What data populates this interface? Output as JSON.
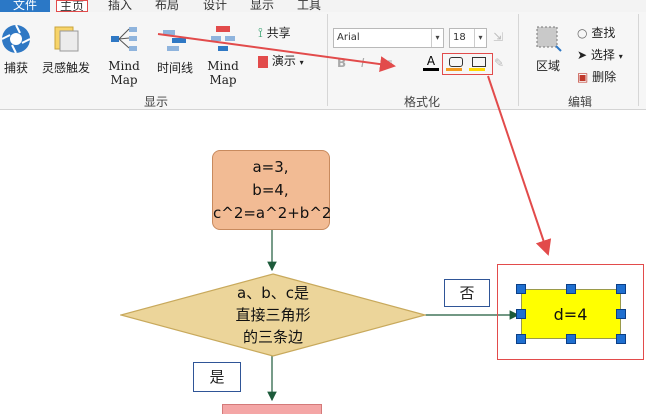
{
  "tabs": [
    "文件",
    "主页",
    "插入",
    "布局",
    "设计",
    "显示",
    "工具"
  ],
  "ribbon": {
    "capture": "捕获",
    "inspire": "灵感触发",
    "mindmap1": "Mind Map",
    "timeline": "时间线",
    "mindmap2": "Mind Map",
    "share": "共享",
    "present": "演示",
    "group_show": "显示",
    "font_name": "Arial",
    "font_size": "18",
    "bold": "B",
    "italic": "I",
    "group_format": "格式化",
    "region": "区域",
    "find": "查找",
    "select": "选择",
    "delete": "删除",
    "group_edit": "编辑"
  },
  "flow": {
    "start_line1": "a=3,",
    "start_line2": "b=4,",
    "start_line3": "c^2=a^2+b^2",
    "decision_line1": "a、b、c是",
    "decision_line2": "直接三角形",
    "decision_line3": "的三条边",
    "no_label": "否",
    "yes_label": "是",
    "result": "d=4"
  },
  "colors": {
    "accent": "#e24b4b",
    "start_fill": "#f2bb94",
    "decision_fill": "#ecd59a",
    "result_fill": "#ffff00",
    "bottom_fill": "#f4a6a6"
  }
}
